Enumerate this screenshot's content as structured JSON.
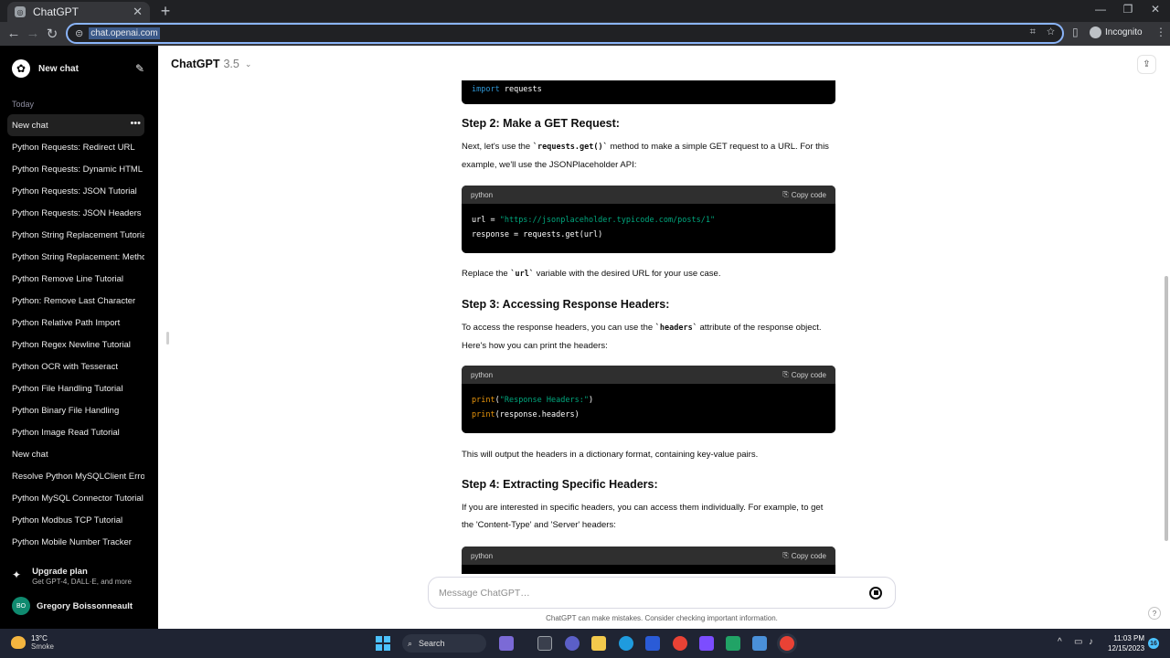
{
  "browser": {
    "tab_title": "ChatGPT",
    "url": "chat.openai.com",
    "profile_label": "Incognito"
  },
  "sidebar": {
    "new_chat_label": "New chat",
    "today_label": "Today",
    "items": [
      {
        "label": "New chat"
      },
      {
        "label": "Python Requests: Redirect URL"
      },
      {
        "label": "Python Requests: Dynamic HTML"
      },
      {
        "label": "Python Requests: JSON Tutorial"
      },
      {
        "label": "Python Requests: JSON Headers"
      },
      {
        "label": "Python String Replacement Tutorial"
      },
      {
        "label": "Python String Replacement: Methods"
      },
      {
        "label": "Python Remove Line Tutorial"
      },
      {
        "label": "Python: Remove Last Character"
      },
      {
        "label": "Python Relative Path Import"
      },
      {
        "label": "Python Regex Newline Tutorial"
      },
      {
        "label": "Python OCR with Tesseract"
      },
      {
        "label": "Python File Handling Tutorial"
      },
      {
        "label": "Python Binary File Handling"
      },
      {
        "label": "Python Image Read Tutorial"
      },
      {
        "label": "New chat"
      },
      {
        "label": "Resolve Python MySQLClient Error"
      },
      {
        "label": "Python MySQL Connector Tutorial"
      },
      {
        "label": "Python Modbus TCP Tutorial"
      },
      {
        "label": "Python Mobile Number Tracker"
      }
    ],
    "upgrade_title": "Upgrade plan",
    "upgrade_subtitle": "Get GPT-4, DALL·E, and more",
    "user_initials": "BO",
    "user_name": "Gregory Boissonneault"
  },
  "header": {
    "model": "ChatGPT",
    "version": "3.5"
  },
  "conversation": {
    "code0": {
      "kw": "import",
      "rest": " requests"
    },
    "step2_heading": "Step 2: Make a GET Request:",
    "step2_p1_a": "Next, let's use the ",
    "step2_p1_code": "`requests.get()`",
    "step2_p1_b": " method to make a simple GET request to a URL. For this example, we'll use the JSONPlaceholder API:",
    "code1": {
      "lang": "python",
      "copy_label": "Copy code",
      "line1_var": "url = ",
      "line1_str": "\"https://jsonplaceholder.typicode.com/posts/1\"",
      "line2": "response = requests.get(url)"
    },
    "step2_p2_a": "Replace the ",
    "step2_p2_code": "`url`",
    "step2_p2_b": " variable with the desired URL for your use case.",
    "step3_heading": "Step 3: Accessing Response Headers:",
    "step3_p1_a": "To access the response headers, you can use the ",
    "step3_p1_code": "`headers`",
    "step3_p1_b": " attribute of the response object. Here's how you can print the headers:",
    "code2": {
      "lang": "python",
      "copy_label": "Copy code",
      "line1_fn": "print",
      "line1_open": "(",
      "line1_str": "\"Response Headers:\"",
      "line1_close": ")",
      "line2_fn": "print",
      "line2_rest": "(response.headers)"
    },
    "step3_p2": "This will output the headers in a dictionary format, containing key-value pairs.",
    "step4_heading": "Step 4: Extracting Specific Headers:",
    "step4_p1": "If you are interested in specific headers, you can access them individually. For example, to get the 'Content-Type' and 'Server' headers:",
    "code3": {
      "lang": "python",
      "copy_label": "Copy code"
    }
  },
  "composer": {
    "placeholder": "Message ChatGPT…",
    "disclaimer": "ChatGPT can make mistakes. Consider checking important information."
  },
  "taskbar": {
    "temp": "13°C",
    "weather": "Smoke",
    "search_label": "Search",
    "time": "11:03 PM",
    "date": "12/15/2023",
    "notif_count": "16"
  },
  "colors": {
    "sidebar_bg": "#000000",
    "keyword": "#2e95d3",
    "string": "#00a67d",
    "function": "#e9950c",
    "avatar": "#0f8a6f"
  }
}
